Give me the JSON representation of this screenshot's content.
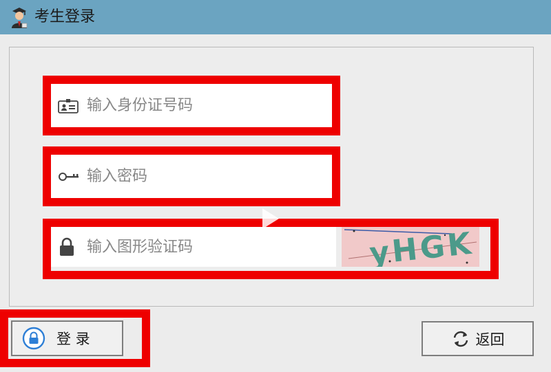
{
  "window": {
    "title": "考生登录"
  },
  "form": {
    "id_placeholder": "输入身份证号码",
    "password_placeholder": "输入密码",
    "captcha_placeholder": "输入图形验证码",
    "captcha_text": "yHGK"
  },
  "buttons": {
    "login_label": "登 录",
    "back_label": "返回"
  },
  "icons": {
    "title": "student-avatar-icon",
    "id": "id-card-icon",
    "password": "key-icon",
    "captcha": "lock-icon",
    "login": "padlock-icon",
    "back": "refresh-icon",
    "overlay": "play-icon"
  },
  "colors": {
    "titlebar": "#6ba4c1",
    "highlight": "#ee0000",
    "background": "#ececec",
    "captcha_bg": "#f1c9c9"
  }
}
